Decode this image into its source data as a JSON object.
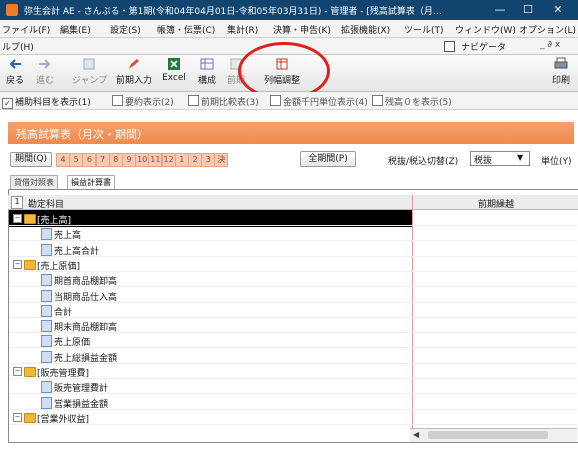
{
  "window": {
    "title": "弥生会計 AE - さんぷる・第1期(令和04年04月01日-令和05年03月31日) - 管理者 - [残高試算表（月…",
    "controls": {
      "minimize": "—",
      "maximize": "☐",
      "close": "✕"
    }
  },
  "menubar": {
    "items": [
      "ファイル(F)",
      "編集(E)",
      "設定(S)",
      "帳簿・伝票(C)",
      "集計(R)",
      "決算・申告(K)",
      "拡張機能(X)",
      "ツール(T)",
      "ウィンドウ(W)",
      "オプション(L)"
    ],
    "row2_left": "ルプ(H)",
    "navigator": "ナビゲータ",
    "row2_right": "_ ∂ x"
  },
  "toolbar": {
    "buttons": [
      {
        "label": "戻る",
        "enabled": true
      },
      {
        "label": "進む",
        "enabled": false
      },
      {
        "label": "ジャンプ",
        "enabled": false
      },
      {
        "label": "前期入力",
        "enabled": true
      },
      {
        "label": "Excel",
        "enabled": true
      },
      {
        "label": "構成",
        "enabled": true
      },
      {
        "label": "前期",
        "enabled": false
      },
      {
        "label": "列幅調整",
        "enabled": true
      }
    ],
    "print_label": "印刷"
  },
  "options": {
    "items": [
      {
        "label": "補助科目を表示(1)",
        "checked": true
      },
      {
        "label": "要約表示(2)",
        "checked": false
      },
      {
        "label": "前期比較表(3)",
        "checked": false
      },
      {
        "label": "金額千円単位表示(4)",
        "checked": false
      },
      {
        "label": "残高０を表示(5)",
        "checked": false
      }
    ]
  },
  "report": {
    "title": "残高試算表（月次・期間）"
  },
  "period": {
    "label": "期間(Q)",
    "cells": [
      "4",
      "5",
      "6",
      "7",
      "8",
      "9",
      "10",
      "11",
      "12",
      "1",
      "2",
      "3",
      "決"
    ],
    "all_button": "全期間(P)",
    "tax_label": "税抜/税込切替(Z)",
    "tax_value": "税抜",
    "unit_label": "単位(Y)"
  },
  "tabs": {
    "items": [
      "貸借対照表",
      "損益計算書"
    ],
    "active": 1
  },
  "grid": {
    "row_number": "1",
    "col_account": "勘定科目",
    "col_prev": "前期繰越",
    "rows": [
      {
        "label": "[売上高]",
        "level": 0,
        "kind": "group",
        "selected": true
      },
      {
        "label": "売上高",
        "level": 1,
        "kind": "item"
      },
      {
        "label": "売上高合計",
        "level": 1,
        "kind": "item"
      },
      {
        "label": "[売上原価]",
        "level": 0,
        "kind": "group"
      },
      {
        "label": "期首商品棚卸高",
        "level": 1,
        "kind": "item"
      },
      {
        "label": "当期商品仕入高",
        "level": 1,
        "kind": "item"
      },
      {
        "label": "合計",
        "level": 1,
        "kind": "item"
      },
      {
        "label": "期末商品棚卸高",
        "level": 1,
        "kind": "item"
      },
      {
        "label": "売上原価",
        "level": 1,
        "kind": "item"
      },
      {
        "label": "売上総損益金額",
        "level": 1,
        "kind": "item"
      },
      {
        "label": "[販売管理費]",
        "level": 0,
        "kind": "group"
      },
      {
        "label": "販売管理費計",
        "level": 1,
        "kind": "item"
      },
      {
        "label": "営業損益金額",
        "level": 1,
        "kind": "item"
      },
      {
        "label": "[営業外収益]",
        "level": 0,
        "kind": "group"
      }
    ]
  },
  "colors": {
    "titlebar": "#11446f",
    "report_header": "#ee8a4c",
    "annotation": "#e0211b",
    "selected_row": "#000000"
  },
  "icons": {
    "back": "back-arrow-icon",
    "forward": "forward-arrow-icon",
    "folder": "folder-icon",
    "sheet": "sheet-icon"
  }
}
